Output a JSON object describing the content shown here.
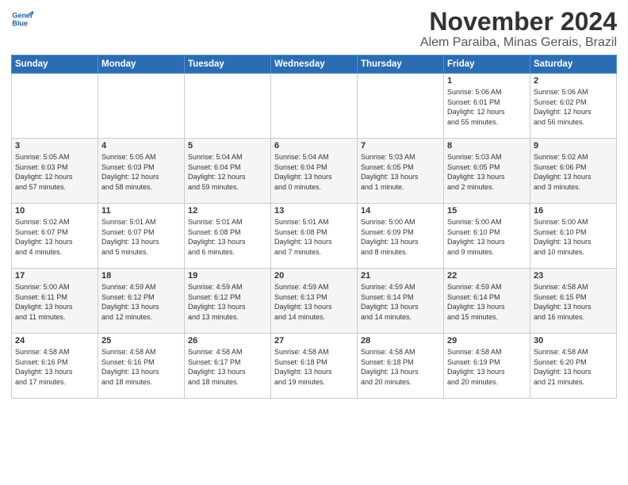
{
  "logo": {
    "line1": "General",
    "line2": "Blue"
  },
  "title": "November 2024",
  "location": "Alem Paraiba, Minas Gerais, Brazil",
  "days_of_week": [
    "Sunday",
    "Monday",
    "Tuesday",
    "Wednesday",
    "Thursday",
    "Friday",
    "Saturday"
  ],
  "weeks": [
    [
      {
        "day": "",
        "info": ""
      },
      {
        "day": "",
        "info": ""
      },
      {
        "day": "",
        "info": ""
      },
      {
        "day": "",
        "info": ""
      },
      {
        "day": "",
        "info": ""
      },
      {
        "day": "1",
        "info": "Sunrise: 5:06 AM\nSunset: 6:01 PM\nDaylight: 12 hours\nand 55 minutes."
      },
      {
        "day": "2",
        "info": "Sunrise: 5:06 AM\nSunset: 6:02 PM\nDaylight: 12 hours\nand 56 minutes."
      }
    ],
    [
      {
        "day": "3",
        "info": "Sunrise: 5:05 AM\nSunset: 6:03 PM\nDaylight: 12 hours\nand 57 minutes."
      },
      {
        "day": "4",
        "info": "Sunrise: 5:05 AM\nSunset: 6:03 PM\nDaylight: 12 hours\nand 58 minutes."
      },
      {
        "day": "5",
        "info": "Sunrise: 5:04 AM\nSunset: 6:04 PM\nDaylight: 12 hours\nand 59 minutes."
      },
      {
        "day": "6",
        "info": "Sunrise: 5:04 AM\nSunset: 6:04 PM\nDaylight: 13 hours\nand 0 minutes."
      },
      {
        "day": "7",
        "info": "Sunrise: 5:03 AM\nSunset: 6:05 PM\nDaylight: 13 hours\nand 1 minute."
      },
      {
        "day": "8",
        "info": "Sunrise: 5:03 AM\nSunset: 6:05 PM\nDaylight: 13 hours\nand 2 minutes."
      },
      {
        "day": "9",
        "info": "Sunrise: 5:02 AM\nSunset: 6:06 PM\nDaylight: 13 hours\nand 3 minutes."
      }
    ],
    [
      {
        "day": "10",
        "info": "Sunrise: 5:02 AM\nSunset: 6:07 PM\nDaylight: 13 hours\nand 4 minutes."
      },
      {
        "day": "11",
        "info": "Sunrise: 5:01 AM\nSunset: 6:07 PM\nDaylight: 13 hours\nand 5 minutes."
      },
      {
        "day": "12",
        "info": "Sunrise: 5:01 AM\nSunset: 6:08 PM\nDaylight: 13 hours\nand 6 minutes."
      },
      {
        "day": "13",
        "info": "Sunrise: 5:01 AM\nSunset: 6:08 PM\nDaylight: 13 hours\nand 7 minutes."
      },
      {
        "day": "14",
        "info": "Sunrise: 5:00 AM\nSunset: 6:09 PM\nDaylight: 13 hours\nand 8 minutes."
      },
      {
        "day": "15",
        "info": "Sunrise: 5:00 AM\nSunset: 6:10 PM\nDaylight: 13 hours\nand 9 minutes."
      },
      {
        "day": "16",
        "info": "Sunrise: 5:00 AM\nSunset: 6:10 PM\nDaylight: 13 hours\nand 10 minutes."
      }
    ],
    [
      {
        "day": "17",
        "info": "Sunrise: 5:00 AM\nSunset: 6:11 PM\nDaylight: 13 hours\nand 11 minutes."
      },
      {
        "day": "18",
        "info": "Sunrise: 4:59 AM\nSunset: 6:12 PM\nDaylight: 13 hours\nand 12 minutes."
      },
      {
        "day": "19",
        "info": "Sunrise: 4:59 AM\nSunset: 6:12 PM\nDaylight: 13 hours\nand 13 minutes."
      },
      {
        "day": "20",
        "info": "Sunrise: 4:59 AM\nSunset: 6:13 PM\nDaylight: 13 hours\nand 14 minutes."
      },
      {
        "day": "21",
        "info": "Sunrise: 4:59 AM\nSunset: 6:14 PM\nDaylight: 13 hours\nand 14 minutes."
      },
      {
        "day": "22",
        "info": "Sunrise: 4:59 AM\nSunset: 6:14 PM\nDaylight: 13 hours\nand 15 minutes."
      },
      {
        "day": "23",
        "info": "Sunrise: 4:58 AM\nSunset: 6:15 PM\nDaylight: 13 hours\nand 16 minutes."
      }
    ],
    [
      {
        "day": "24",
        "info": "Sunrise: 4:58 AM\nSunset: 6:16 PM\nDaylight: 13 hours\nand 17 minutes."
      },
      {
        "day": "25",
        "info": "Sunrise: 4:58 AM\nSunset: 6:16 PM\nDaylight: 13 hours\nand 18 minutes."
      },
      {
        "day": "26",
        "info": "Sunrise: 4:58 AM\nSunset: 6:17 PM\nDaylight: 13 hours\nand 18 minutes."
      },
      {
        "day": "27",
        "info": "Sunrise: 4:58 AM\nSunset: 6:18 PM\nDaylight: 13 hours\nand 19 minutes."
      },
      {
        "day": "28",
        "info": "Sunrise: 4:58 AM\nSunset: 6:18 PM\nDaylight: 13 hours\nand 20 minutes."
      },
      {
        "day": "29",
        "info": "Sunrise: 4:58 AM\nSunset: 6:19 PM\nDaylight: 13 hours\nand 20 minutes."
      },
      {
        "day": "30",
        "info": "Sunrise: 4:58 AM\nSunset: 6:20 PM\nDaylight: 13 hours\nand 21 minutes."
      }
    ]
  ]
}
